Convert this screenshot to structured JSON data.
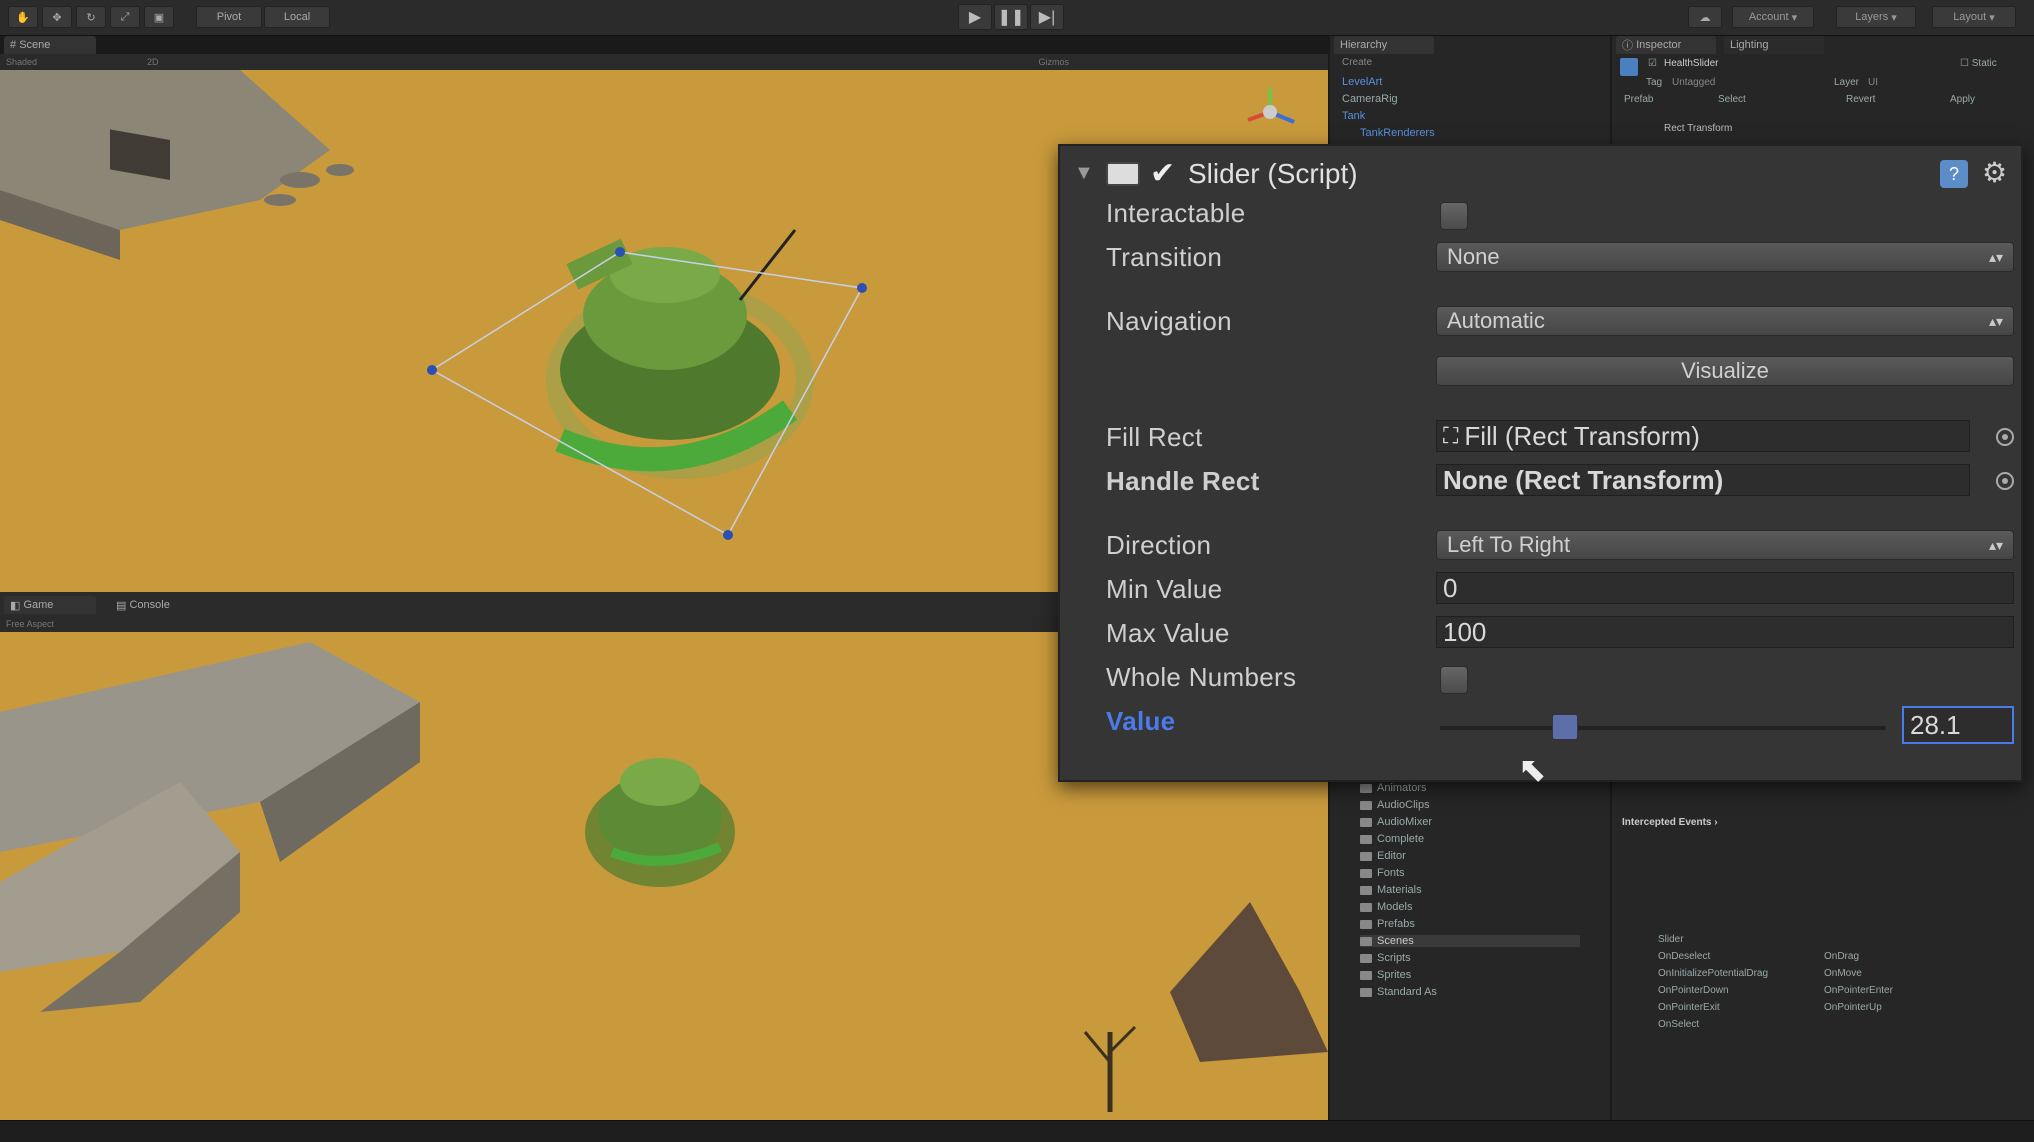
{
  "toolbar": {
    "pivot_label": "Pivot",
    "local_label": "Local",
    "account_label": "Account",
    "layers_label": "Layers",
    "layout_label": "Layout"
  },
  "scene": {
    "tab_label": "Scene",
    "shading_label": "Shaded",
    "mode_2d_label": "2D",
    "gizmos_label": "Gizmos"
  },
  "game": {
    "tab_label": "Game",
    "console_tab_label": "Console",
    "aspect_label": "Free Aspect"
  },
  "hierarchy": {
    "tab_label": "Hierarchy",
    "create_label": "Create",
    "items": [
      "LevelArt",
      "CameraRig",
      "Tank",
      "TankRenderers"
    ]
  },
  "inspector": {
    "tab_label": "Inspector",
    "lighting_tab_label": "Lighting",
    "object_name": "HealthSlider",
    "static_label": "Static",
    "tag_label": "Tag",
    "tag_value": "Untagged",
    "layer_label": "Layer",
    "layer_value": "UI",
    "prefab_label": "Prefab",
    "prefab_select": "Select",
    "prefab_revert": "Revert",
    "prefab_apply": "Apply",
    "component_rect": "Rect Transform"
  },
  "slider_component": {
    "title": "Slider (Script)",
    "interactable_label": "Interactable",
    "transition_label": "Transition",
    "transition_value": "None",
    "navigation_label": "Navigation",
    "navigation_value": "Automatic",
    "visualize_label": "Visualize",
    "fill_rect_label": "Fill Rect",
    "fill_rect_value": "Fill (Rect Transform)",
    "handle_rect_label": "Handle Rect",
    "handle_rect_value": "None (Rect Transform)",
    "direction_label": "Direction",
    "direction_value": "Left To Right",
    "min_value_label": "Min Value",
    "min_value": "0",
    "max_value_label": "Max Value",
    "max_value": "100",
    "whole_numbers_label": "Whole Numbers",
    "value_label": "Value",
    "value": "28.1",
    "value_fraction": 0.281
  },
  "project": {
    "folders": [
      "Animators",
      "AudioClips",
      "AudioMixer",
      "Complete",
      "Editor",
      "Fonts",
      "Materials",
      "Models",
      "Prefabs",
      "Scenes",
      "Scripts",
      "Sprites",
      "Standard As"
    ]
  },
  "events": {
    "header": "Intercepted Events",
    "component": "Slider",
    "col1": [
      "OnDeselect",
      "OnInitializePotentialDrag",
      "OnPointerDown",
      "OnPointerExit",
      "OnSelect"
    ],
    "col2": [
      "OnDrag",
      "OnMove",
      "OnPointerEnter",
      "OnPointerUp"
    ]
  },
  "colors": {
    "accent": "#4a7bea",
    "sand": "#c99a3c",
    "tank_green": "#5d8a34"
  }
}
